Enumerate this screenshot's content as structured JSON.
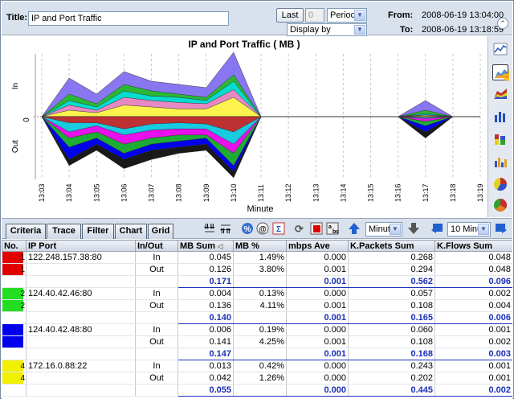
{
  "header": {
    "title_label": "Title:",
    "title_value": "IP and Port Traffic",
    "last_button": "Last",
    "last_count": "0",
    "period_select": "Period",
    "display_by_select": "Display by",
    "from_label": "From:",
    "from_value": "2008-06-19 13:04:00",
    "to_label": "To:",
    "to_value": "2008-06-19 13:18:59"
  },
  "chart_data": {
    "type": "area",
    "title": "IP and Port Traffic ( MB )",
    "xlabel": "Minute",
    "ylabel_top": "In",
    "ylabel_bottom": "Out",
    "y_zero_label": "0",
    "categories": [
      "13:03",
      "13:04",
      "13:05",
      "13:06",
      "13:07",
      "13:08",
      "13:09",
      "13:10",
      "13:11",
      "13:12",
      "13:13",
      "13:14",
      "13:15",
      "13:16",
      "13:17",
      "13:18",
      "13:19"
    ],
    "grid": true,
    "in_series": [
      {
        "color": "#7b68ee",
        "values": [
          0,
          0.6,
          0.35,
          0.7,
          0.55,
          0.5,
          0.45,
          1.0,
          0,
          0,
          0,
          0,
          0,
          0,
          0.25,
          0,
          0
        ]
      },
      {
        "color": "#20c020",
        "values": [
          0,
          0.35,
          0.2,
          0.5,
          0.4,
          0.35,
          0.3,
          0.65,
          0,
          0,
          0,
          0,
          0,
          0,
          0.1,
          0,
          0
        ]
      },
      {
        "color": "#00e0e0",
        "values": [
          0,
          0.25,
          0.15,
          0.4,
          0.32,
          0.3,
          0.25,
          0.55,
          0,
          0,
          0,
          0,
          0,
          0,
          0.05,
          0,
          0
        ]
      },
      {
        "color": "#ff80c0",
        "values": [
          0,
          0.18,
          0.1,
          0.3,
          0.25,
          0.22,
          0.2,
          0.42,
          0,
          0,
          0,
          0,
          0,
          0,
          0.03,
          0,
          0
        ]
      },
      {
        "color": "#ffff40",
        "values": [
          0,
          0.1,
          0.06,
          0.18,
          0.15,
          0.12,
          0.12,
          0.3,
          0,
          0,
          0,
          0,
          0,
          0,
          0.02,
          0,
          0
        ]
      }
    ],
    "out_series": [
      {
        "color": "#000000",
        "values": [
          0,
          0.8,
          0.55,
          0.85,
          0.7,
          0.6,
          0.55,
          1.0,
          0,
          0,
          0,
          0,
          0,
          0,
          0.35,
          0,
          0
        ]
      },
      {
        "color": "#0000ff",
        "values": [
          0,
          0.7,
          0.45,
          0.7,
          0.55,
          0.5,
          0.45,
          0.9,
          0,
          0,
          0,
          0,
          0,
          0,
          0.25,
          0,
          0
        ]
      },
      {
        "color": "#20c020",
        "values": [
          0,
          0.5,
          0.35,
          0.6,
          0.45,
          0.4,
          0.35,
          0.8,
          0,
          0,
          0,
          0,
          0,
          0,
          0.15,
          0,
          0
        ]
      },
      {
        "color": "#ff00ff",
        "values": [
          0,
          0.35,
          0.25,
          0.45,
          0.35,
          0.3,
          0.3,
          0.6,
          0,
          0,
          0,
          0,
          0,
          0,
          0.08,
          0,
          0
        ]
      },
      {
        "color": "#00e0e0",
        "values": [
          0,
          0.25,
          0.15,
          0.3,
          0.22,
          0.2,
          0.2,
          0.45,
          0,
          0,
          0,
          0,
          0,
          0,
          0.03,
          0,
          0
        ]
      },
      {
        "color": "#d02020",
        "values": [
          0,
          0.1,
          0.1,
          0.2,
          0.12,
          0.1,
          0.12,
          0.25,
          0,
          0,
          0,
          0,
          0,
          0,
          0.01,
          0,
          0
        ]
      }
    ]
  },
  "sidebar": {
    "icons": [
      "line-chart-icon",
      "area-chart-icon",
      "stacked-area-icon",
      "bar-chart-icon",
      "stacked-bar-icon",
      "grouped-bar-icon",
      "pie-chart-icon",
      "multi-pie-icon"
    ]
  },
  "tabs": [
    {
      "label": "Criteria"
    },
    {
      "label": "Trace"
    },
    {
      "label": "Filter"
    },
    {
      "label": "Chart"
    },
    {
      "label": "Grid"
    }
  ],
  "toolbar": {
    "unit_select": "Minute",
    "interval_select": "10 Minu"
  },
  "grid": {
    "columns": [
      "No.",
      "IP Port",
      "In/Out",
      "MB Sum",
      "MB %",
      "mbps Ave",
      "K.Packets Sum",
      "K.Flows Sum"
    ],
    "groups": [
      {
        "no": "1",
        "color": "#e00000",
        "ip": "122.248.157.38:80",
        "rows": [
          {
            "no": "1",
            "dir": "In",
            "mb": "0.045",
            "pct": "1.49%",
            "mbps": "0.000",
            "kp": "0.268",
            "kf": "0.048"
          },
          {
            "no": "1",
            "dir": "Out",
            "mb": "0.126",
            "pct": "3.80%",
            "mbps": "0.001",
            "kp": "0.294",
            "kf": "0.048"
          }
        ],
        "sum": {
          "mb": "0.171",
          "mbps": "0.001",
          "kp": "0.562",
          "kf": "0.096"
        }
      },
      {
        "no": "2",
        "color": "#22dd22",
        "ip": "124.40.42.46:80",
        "rows": [
          {
            "no": "2",
            "dir": "In",
            "mb": "0.004",
            "pct": "0.13%",
            "mbps": "0.000",
            "kp": "0.057",
            "kf": "0.002"
          },
          {
            "no": "2",
            "dir": "Out",
            "mb": "0.136",
            "pct": "4.11%",
            "mbps": "0.001",
            "kp": "0.108",
            "kf": "0.004"
          }
        ],
        "sum": {
          "mb": "0.140",
          "mbps": "0.001",
          "kp": "0.165",
          "kf": "0.006"
        }
      },
      {
        "no": "",
        "color": "#0000ee",
        "ip": "124.40.42.48:80",
        "rows": [
          {
            "no": "",
            "dir": "In",
            "mb": "0.006",
            "pct": "0.19%",
            "mbps": "0.000",
            "kp": "0.060",
            "kf": "0.001"
          },
          {
            "no": "",
            "dir": "Out",
            "mb": "0.141",
            "pct": "4.25%",
            "mbps": "0.001",
            "kp": "0.108",
            "kf": "0.002"
          }
        ],
        "sum": {
          "mb": "0.147",
          "mbps": "0.001",
          "kp": "0.168",
          "kf": "0.003"
        }
      },
      {
        "no": "4",
        "color": "#f0f000",
        "ip": "172.16.0.88:22",
        "rows": [
          {
            "no": "4",
            "dir": "In",
            "mb": "0.013",
            "pct": "0.42%",
            "mbps": "0.000",
            "kp": "0.243",
            "kf": "0.001"
          },
          {
            "no": "4",
            "dir": "Out",
            "mb": "0.042",
            "pct": "1.26%",
            "mbps": "0.000",
            "kp": "0.202",
            "kf": "0.001"
          }
        ],
        "sum": {
          "mb": "0.055",
          "mbps": "0.000",
          "kp": "0.445",
          "kf": "0.002"
        }
      }
    ]
  }
}
